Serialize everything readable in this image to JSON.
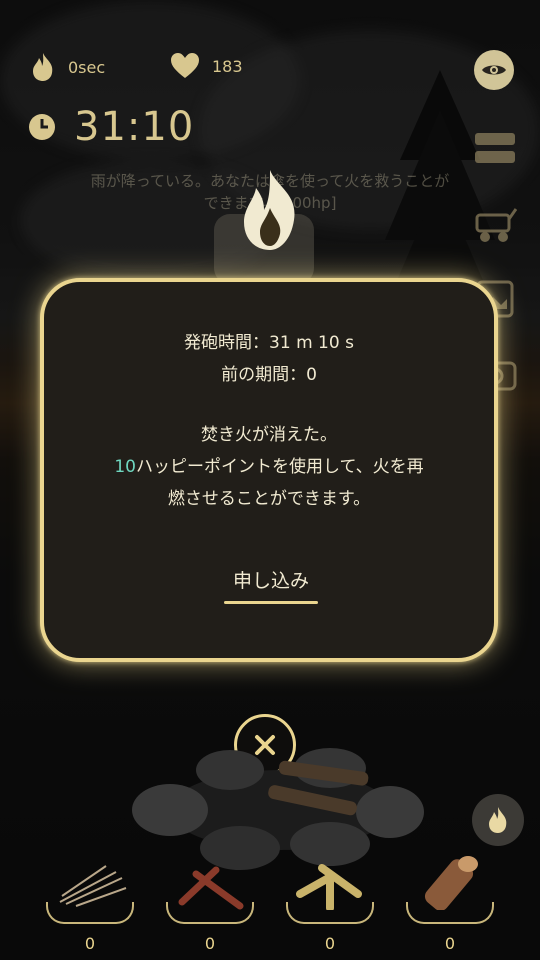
{
  "hud": {
    "burn_time": "0sec",
    "hearts": "183",
    "timer": "31:10",
    "message": "雨が降っている。あなたは傘を使って火を救うことができます。[100hp]"
  },
  "dialog": {
    "firing_time": "発砲時間：31 m 10 s",
    "previous_period": "前の期間：0",
    "extinguished": "焚き火が消えた。",
    "points": "10",
    "points_text": "ハッピーポイントを使用して、火を再",
    "points_text_2": "燃させることができます。",
    "apply_label": "申し込み"
  },
  "inventory": [
    {
      "name": "twigs",
      "count": "0"
    },
    {
      "name": "sticks",
      "count": "0"
    },
    {
      "name": "kindling",
      "count": "0"
    },
    {
      "name": "log",
      "count": "0"
    }
  ],
  "colors": {
    "accent": "#ead58f",
    "highlight": "#6fd7c0",
    "panel": "#211e19"
  },
  "icons": [
    "flame-icon",
    "heart-icon",
    "clock-icon",
    "eye-icon",
    "wood-pile-icon",
    "wagon-icon",
    "picture-icon",
    "camera-icon",
    "close-icon",
    "fire-button-icon"
  ]
}
